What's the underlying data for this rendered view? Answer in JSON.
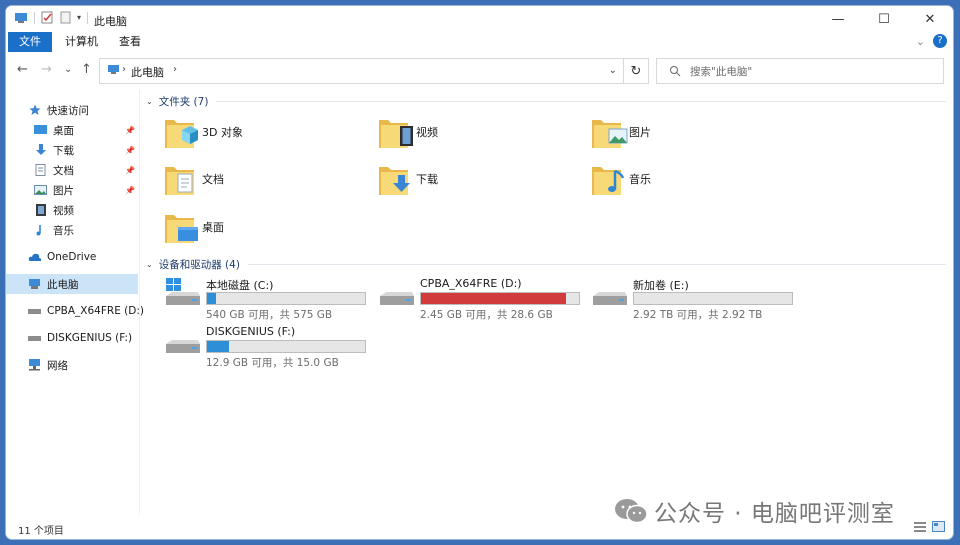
{
  "window": {
    "title": "此电脑",
    "controls": {
      "minimize": "—",
      "maximize": "☐",
      "close": "✕"
    }
  },
  "ribbon": {
    "tabs": [
      "文件",
      "计算机",
      "查看"
    ],
    "help": "?"
  },
  "nav": {
    "back": "←",
    "forward": "→",
    "recent": "⌄",
    "up": "↑",
    "breadcrumb": "此电脑",
    "refresh": "↻",
    "search_placeholder": "搜索\"此电脑\""
  },
  "sidebar": {
    "items": [
      {
        "label": "快速访问",
        "icon": "star-icon"
      },
      {
        "label": "桌面",
        "icon": "desktop-icon",
        "pinned": true
      },
      {
        "label": "下载",
        "icon": "download-icon",
        "pinned": true
      },
      {
        "label": "文档",
        "icon": "document-icon",
        "pinned": true
      },
      {
        "label": "图片",
        "icon": "picture-icon",
        "pinned": true
      },
      {
        "label": "视频",
        "icon": "video-icon"
      },
      {
        "label": "音乐",
        "icon": "music-icon"
      },
      {
        "label": "OneDrive",
        "icon": "cloud-icon"
      },
      {
        "label": "此电脑",
        "icon": "computer-icon",
        "selected": true
      },
      {
        "label": "CPBA_X64FRE (D:)",
        "icon": "drive-icon"
      },
      {
        "label": "DISKGENIUS (F:)",
        "icon": "drive-icon"
      },
      {
        "label": "网络",
        "icon": "network-icon"
      }
    ]
  },
  "folders_group": {
    "title": "文件夹 (7)",
    "items": [
      {
        "label": "3D 对象",
        "overlay": "cube"
      },
      {
        "label": "视频",
        "overlay": "film"
      },
      {
        "label": "图片",
        "overlay": "picture"
      },
      {
        "label": "文档",
        "overlay": "doc"
      },
      {
        "label": "下载",
        "overlay": "download"
      },
      {
        "label": "音乐",
        "overlay": "music"
      },
      {
        "label": "桌面",
        "overlay": "desktop"
      }
    ]
  },
  "drives_group": {
    "title": "设备和驱动器 (4)",
    "items": [
      {
        "name": "本地磁盘 (C:)",
        "size": "540 GB 可用，共 575 GB",
        "used_fraction": 0.06,
        "color": "#2e8fd7",
        "system": true
      },
      {
        "name": "CPBA_X64FRE (D:)",
        "size": "2.45 GB 可用，共 28.6 GB",
        "used_fraction": 0.92,
        "color": "#d23b3b"
      },
      {
        "name": "新加卷 (E:)",
        "size": "2.92 TB 可用，共 2.92 TB",
        "used_fraction": 0.0,
        "color": "#2e8fd7"
      },
      {
        "name": "DISKGENIUS (F:)",
        "size": "12.9 GB 可用，共 15.0 GB",
        "used_fraction": 0.14,
        "color": "#2e8fd7"
      }
    ]
  },
  "statusbar": {
    "count": "11 个项目"
  },
  "watermark": {
    "text": "公众号 · 电脑吧评测室"
  }
}
